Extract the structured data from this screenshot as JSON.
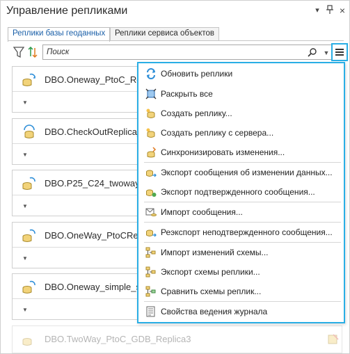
{
  "window": {
    "title": "Управление репликами",
    "pin_icon": "pin-icon",
    "close_icon": "close-icon"
  },
  "tabs": [
    {
      "label": "Реплики базы геоданных",
      "active": true
    },
    {
      "label": "Реплики сервиса объектов",
      "active": false
    }
  ],
  "toolbar": {
    "filter_icon": "filter-icon",
    "sort_icon": "sort-icon",
    "search_placeholder": "Поиск",
    "menu_icon": "hamburger-menu-icon"
  },
  "replicas": [
    {
      "name": "DBO.Oneway_PtoC_Replica"
    },
    {
      "name": "DBO.CheckOutReplica_"
    },
    {
      "name": "DBO.P25_C24_twoway"
    },
    {
      "name": "DBO.OneWay_PtoCReplica"
    },
    {
      "name": "DBO.Oneway_simple_sub"
    },
    {
      "name": "DBO.TwoWay_PtoC_GDB_Replica3"
    }
  ],
  "menu": {
    "items": [
      {
        "label": "Обновить реплики",
        "icon": "refresh-icon"
      },
      {
        "label": "Раскрыть все",
        "icon": "expand-all-icon"
      },
      {
        "label": "Создать реплику...",
        "icon": "create-replica-icon"
      },
      {
        "label": "Создать реплику с сервера...",
        "icon": "create-replica-server-icon"
      },
      {
        "label": "Синхронизировать изменения...",
        "icon": "synchronize-icon"
      },
      {
        "label": "Экспорт сообщения об изменении данных...",
        "icon": "export-data-change-icon"
      },
      {
        "label": "Экспорт подтвержденного сообщения...",
        "icon": "export-ack-icon"
      },
      {
        "label": "Импорт сообщения...",
        "icon": "import-message-icon"
      },
      {
        "label": "Реэкспорт неподтвержденного сообщения...",
        "icon": "reexport-icon"
      },
      {
        "label": "Импорт изменений схемы...",
        "icon": "import-schema-icon"
      },
      {
        "label": "Экспорт схемы реплики...",
        "icon": "export-schema-icon"
      },
      {
        "label": "Сравнить схемы реплик...",
        "icon": "compare-schema-icon"
      },
      {
        "label": "Свойства ведения журнала",
        "icon": "logging-properties-icon"
      }
    ]
  }
}
